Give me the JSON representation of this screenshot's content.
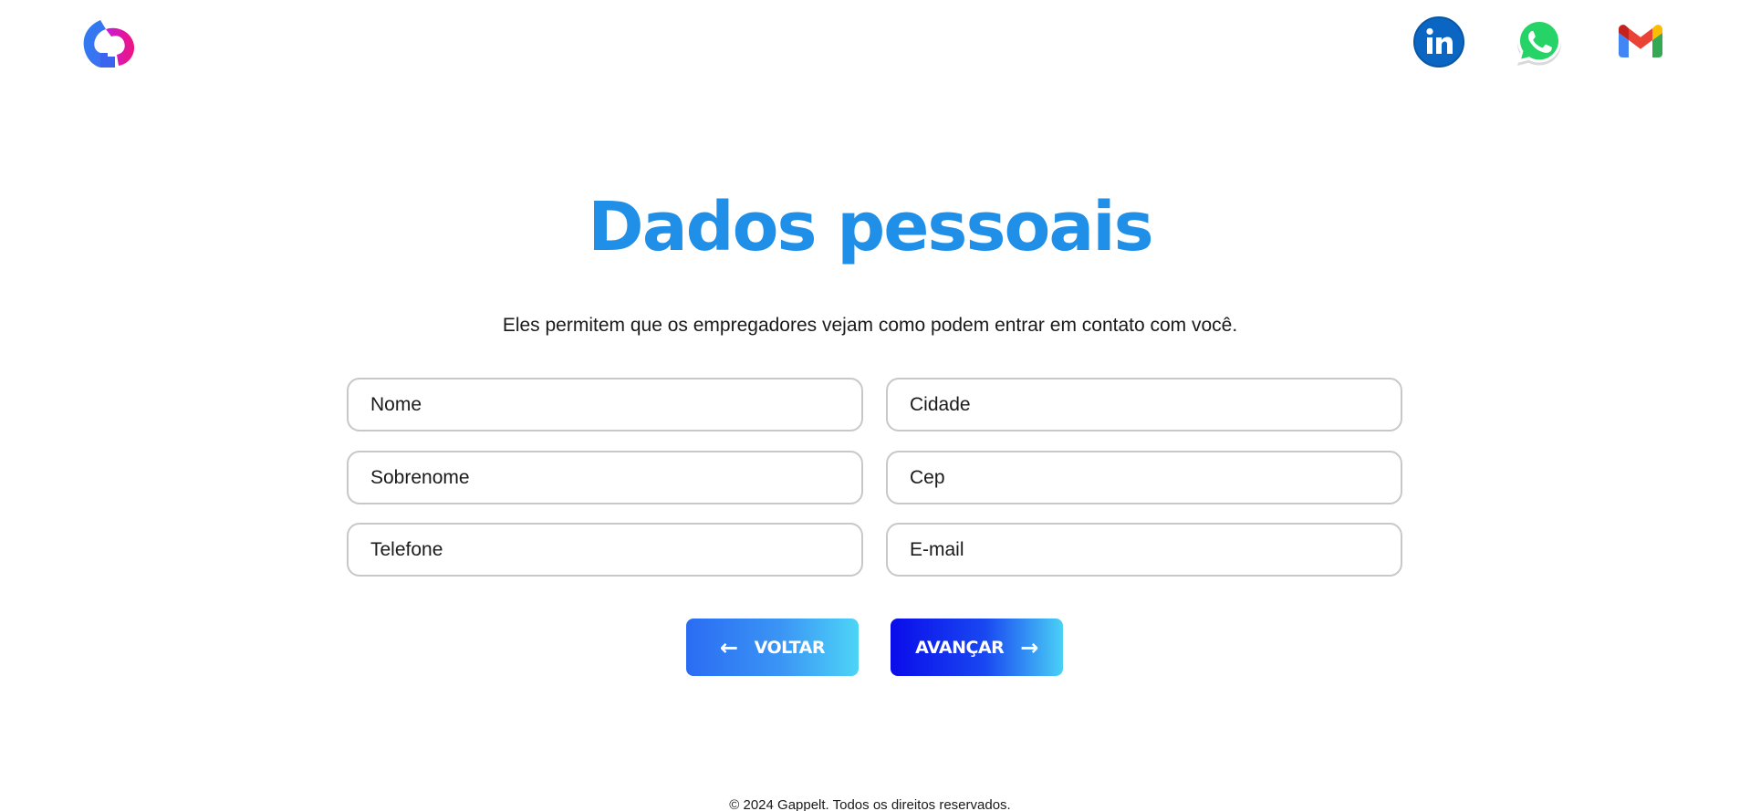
{
  "header": {
    "logo_icon": "gappelt-logo-icon",
    "social": [
      {
        "name": "linkedin-icon",
        "color": "#0a66c2"
      },
      {
        "name": "whatsapp-icon",
        "color": "#25d366"
      },
      {
        "name": "gmail-icon",
        "color": "#ea4335"
      }
    ]
  },
  "main": {
    "title": "Dados pessoais",
    "subtitle": "Eles permitem que os empregadores vejam como podem entrar em contato com você.",
    "fields": {
      "nome": {
        "placeholder": "Nome",
        "value": ""
      },
      "cidade": {
        "placeholder": "Cidade",
        "value": ""
      },
      "sobrenome": {
        "placeholder": "Sobrenome",
        "value": ""
      },
      "cep": {
        "placeholder": "Cep",
        "value": ""
      },
      "telefone": {
        "placeholder": "Telefone",
        "value": ""
      },
      "email": {
        "placeholder": "E-mail",
        "value": ""
      }
    },
    "buttons": {
      "back_label": "VOLTAR",
      "back_icon": "arrow-left-icon",
      "next_label": "AVANÇAR",
      "next_icon": "arrow-right-icon"
    }
  },
  "footer": {
    "text": "© 2024 Gappelt. Todos os direitos reservados."
  },
  "colors": {
    "title": "#1f8fe8",
    "field_border": "#c8c8c8",
    "back_gradient": [
      "#2a6cf3",
      "#4dd4f6"
    ],
    "next_gradient": [
      "#0a0cea",
      "#4ad0f6"
    ]
  }
}
